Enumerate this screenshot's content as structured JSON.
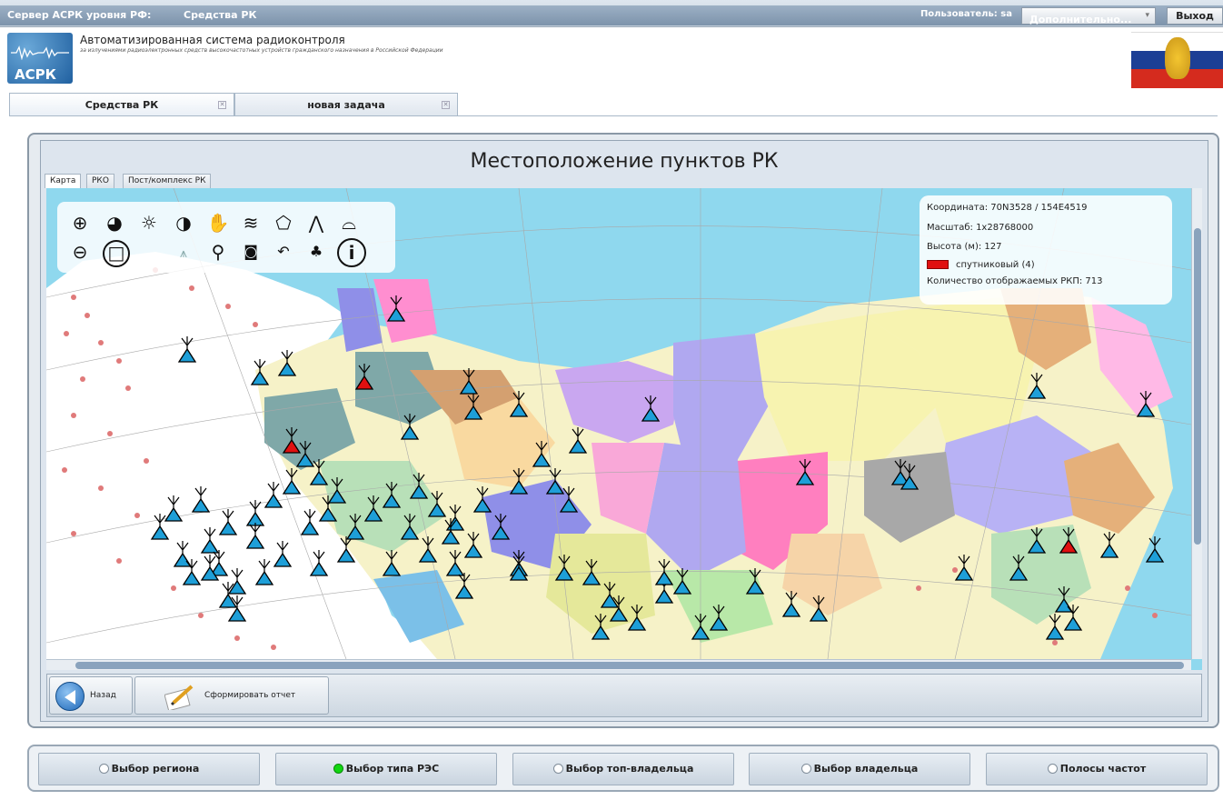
{
  "topbar": {
    "server_label": "Сервер АСРК уровня РФ:",
    "section_label": "Средства РК",
    "user_label": "Пользователь: sa",
    "extra_button": "Дополнительно...",
    "exit_button": "Выход"
  },
  "header": {
    "logo_text": "АСРК",
    "title": "Автоматизированная система радиоконтроля",
    "subtitle": "за излучениями радиоэлектронных средств высокочастотных устройств гражданского назначения в Российской Федерации"
  },
  "tabs": [
    {
      "label": "Средства РК",
      "active": true
    },
    {
      "label": "новая задача",
      "active": false
    }
  ],
  "main": {
    "title": "Местоположение пунктов РК",
    "subtabs": [
      "Карта",
      "РКО",
      "Пост/комплекс РК"
    ]
  },
  "map_info": {
    "coordinate": "Координата: 70N3528 / 154E4519",
    "scale": "Масштаб: 1x28768000",
    "height": "Высота (м): 127",
    "legend_item": "спутниковый (4)",
    "legend_color": "#e01010",
    "count": "Количество отображаемых РКП: 713"
  },
  "map_tools": [
    "zoom-in-icon",
    "globe-icon",
    "brightness-icon",
    "contrast-icon",
    "pan-hand-icon",
    "layers-icon",
    "region-icon",
    "terrain-icon",
    "relief-icon",
    "zoom-out-icon",
    "select-rect-icon",
    "station-icon",
    "search-icon",
    "camera-icon",
    "undo-icon",
    "tree-icon",
    "info-icon"
  ],
  "bottom": {
    "back_label": "Назад",
    "report_label": "Сформировать отчет"
  },
  "filters": [
    {
      "label": "Выбор региона",
      "selected": false
    },
    {
      "label": "Выбор типа РЭС",
      "selected": true
    },
    {
      "label": "Выбор топ-владельца",
      "selected": false
    },
    {
      "label": "Выбор владельца",
      "selected": false
    },
    {
      "label": "Полосы частот",
      "selected": false
    }
  ],
  "colors": {
    "sea": "#8fd8ee",
    "station_marker": "#1e9fd8",
    "satellite_marker": "#e01010"
  }
}
